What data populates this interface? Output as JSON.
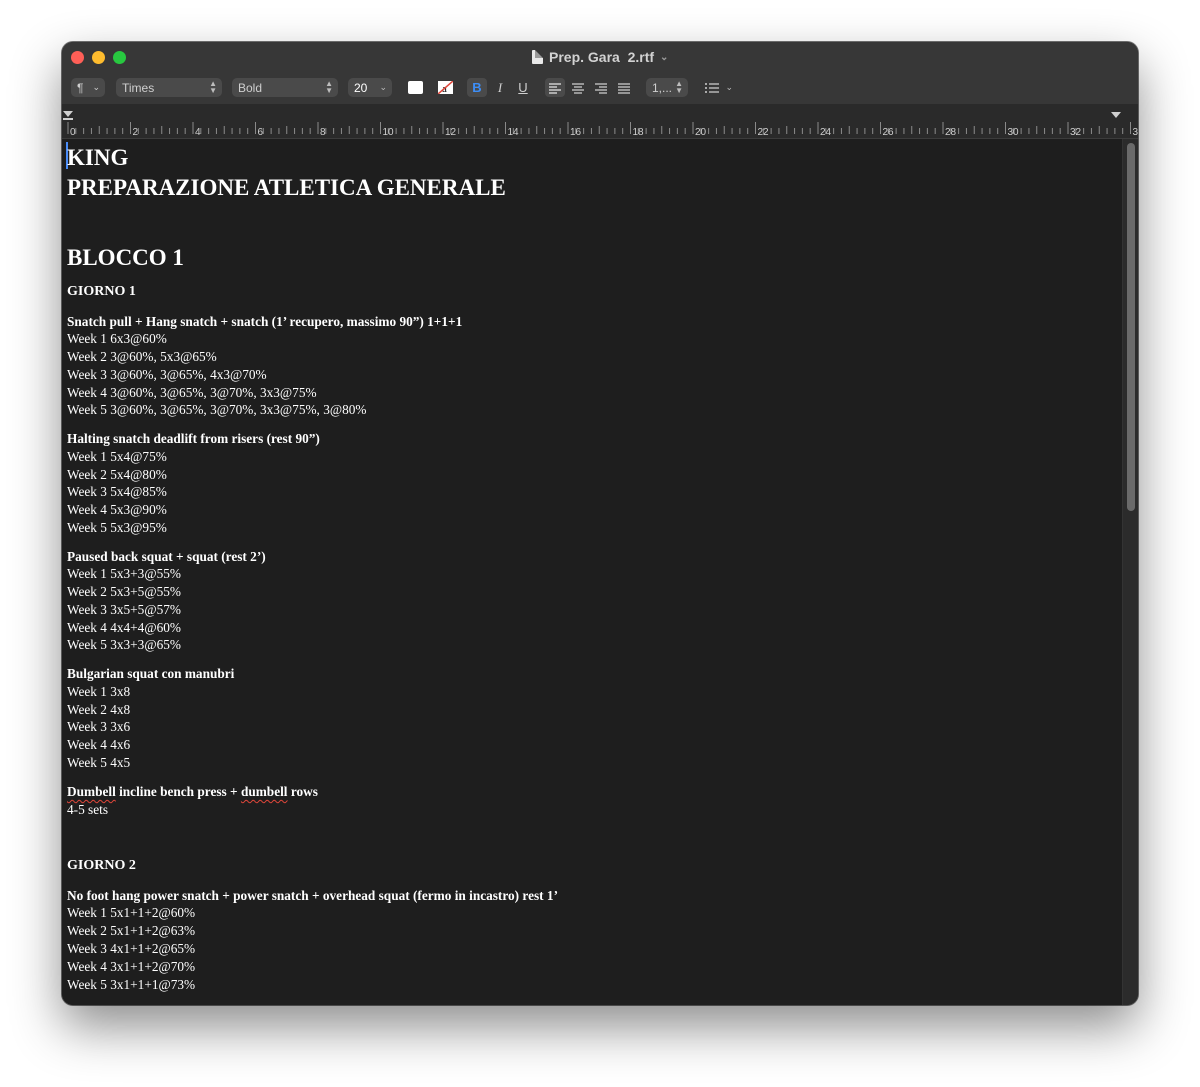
{
  "window": {
    "title": "Prep. Gara  2.rtf",
    "title_chevron": "⌄"
  },
  "toolbar": {
    "paragraph_styles": "¶",
    "font_family": "Times",
    "font_style": "Bold",
    "font_size": "20",
    "bold_label": "B",
    "italic_label": "I",
    "underline_label": "U",
    "line_spacing": "1,...",
    "text_color": "#ffffff",
    "bold_color": "#3d8ef7"
  },
  "ruler": {
    "labels": [
      "0",
      "2",
      "4",
      "6",
      "8",
      "10",
      "12",
      "14",
      "16",
      "18",
      "20",
      "22",
      "24",
      "26",
      "28",
      "30",
      "32",
      "3"
    ]
  },
  "document": {
    "title": "KING",
    "subtitle": "PREPARAZIONE ATLETICA GENERALE",
    "block": "BLOCCO 1",
    "day1": {
      "heading": "GIORNO 1",
      "exercises": [
        {
          "name": "Snatch pull + Hang snatch + snatch (1’ recupero, massimo 90”) 1+1+1",
          "weeks": [
            "Week 1 6x3@60%",
            "Week 2 3@60%, 5x3@65%",
            "Week 3 3@60%, 3@65%, 4x3@70%",
            "Week 4 3@60%, 3@65%, 3@70%, 3x3@75%",
            "Week 5 3@60%, 3@65%, 3@70%, 3x3@75%, 3@80%"
          ]
        },
        {
          "name": "Halting snatch deadlift from risers (rest 90”)",
          "weeks": [
            "Week 1 5x4@75%",
            "Week 2 5x4@80%",
            "Week 3 5x4@85%",
            "Week 4 5x3@90%",
            "Week 5 5x3@95%"
          ]
        },
        {
          "name": "Paused back squat + squat (rest 2’)",
          "weeks": [
            "Week 1 5x3+3@55%",
            "Week 2 5x3+5@55%",
            "Week 3 3x5+5@57%",
            "Week 4 4x4+4@60%",
            "Week 5 3x3+3@65%"
          ]
        },
        {
          "name": "Bulgarian squat con manubri",
          "weeks": [
            "Week 1 3x8",
            "Week 2 4x8",
            "Week 3 3x6",
            "Week 4 4x6",
            "Week 5 4x5"
          ]
        }
      ],
      "last_exercise": {
        "word1": "Dumbell",
        "middle": " incline bench press + ",
        "word2": "dumbell",
        "end": " rows",
        "sets": "4-5 sets"
      }
    },
    "day2": {
      "heading": "GIORNO 2",
      "exercise_name": "No foot hang power snatch + power snatch + overhead squat (fermo in incastro) rest 1’",
      "weeks": [
        "Week 1 5x1+1+2@60%",
        "Week 2 5x1+1+2@63%",
        "Week 3 4x1+1+2@65%",
        "Week 4 3x1+1+2@70%",
        "Week 5 3x1+1+1@73%"
      ]
    }
  }
}
